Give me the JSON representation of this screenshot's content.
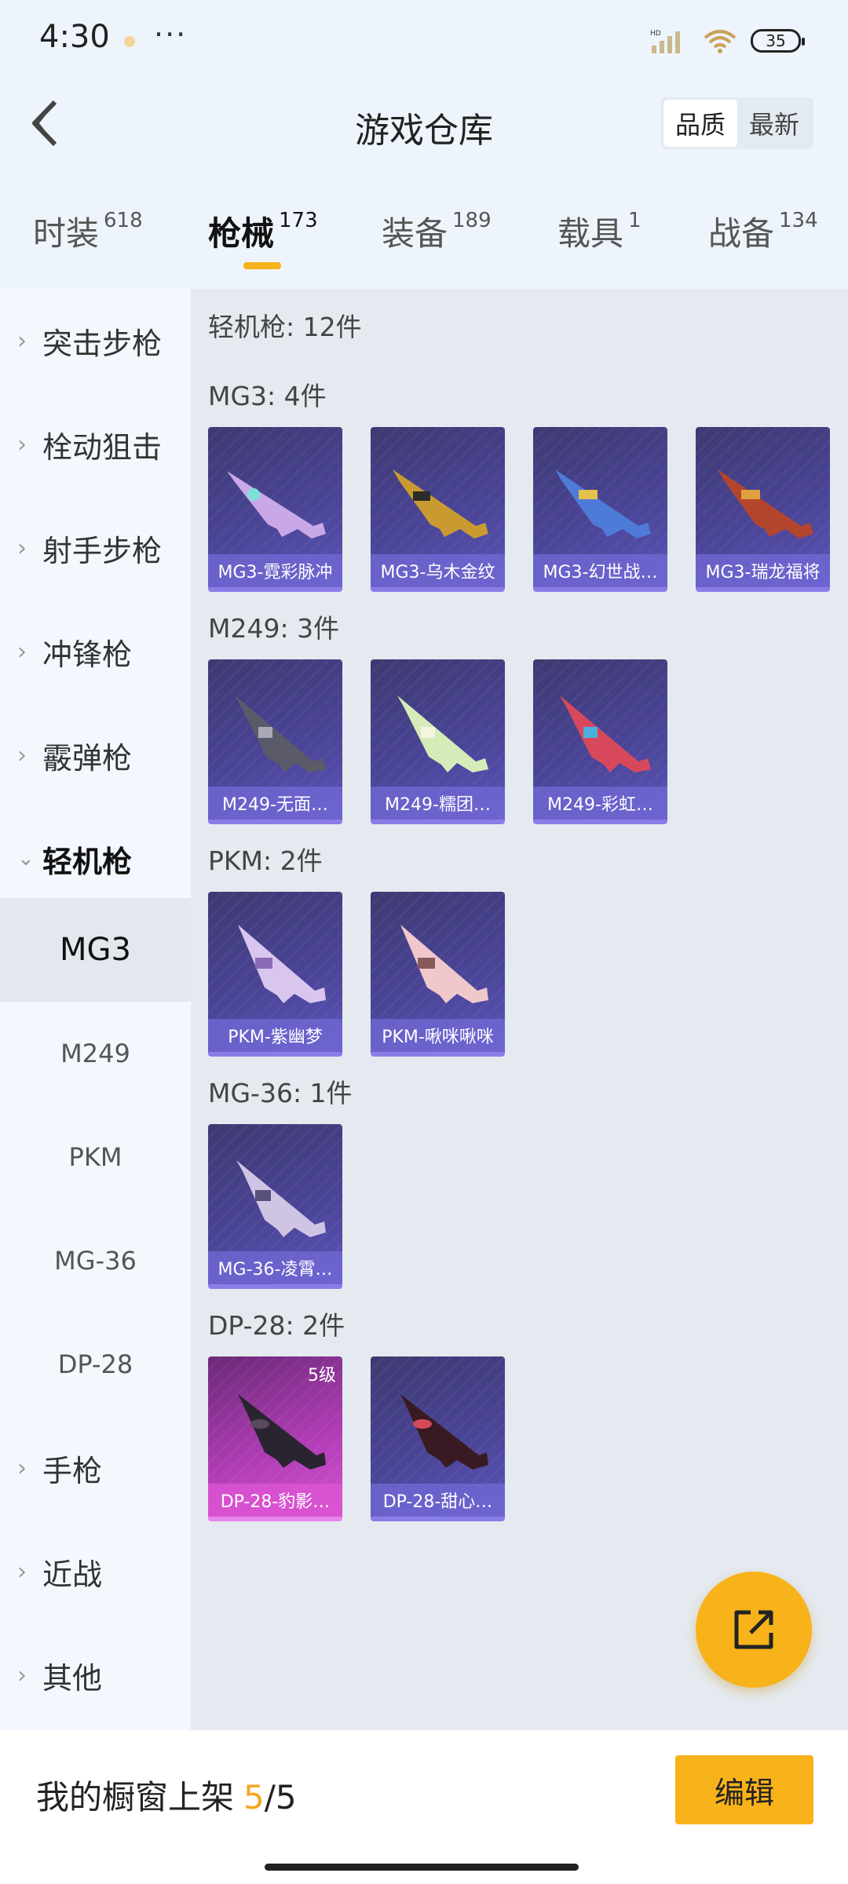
{
  "status": {
    "time": "4:30",
    "more": "···",
    "battery": "35"
  },
  "header": {
    "title": "游戏仓库",
    "sort": [
      "品质",
      "最新"
    ]
  },
  "tabs": [
    {
      "label": "时装",
      "count": "618"
    },
    {
      "label": "枪械",
      "count": "173"
    },
    {
      "label": "装备",
      "count": "189"
    },
    {
      "label": "载具",
      "count": "1"
    },
    {
      "label": "战备",
      "count": "134"
    }
  ],
  "sidebar": {
    "categories": [
      "突击步枪",
      "栓动狙击",
      "射手步枪",
      "冲锋枪",
      "霰弹枪",
      "轻机枪",
      "手枪",
      "近战",
      "其他"
    ],
    "subitems": [
      "MG3",
      "M249",
      "PKM",
      "MG-36",
      "DP-28"
    ]
  },
  "content": {
    "summary": "轻机枪: 12件",
    "groups": [
      {
        "title": "MG3: 4件",
        "items": [
          "MG3-霓彩脉冲",
          "MG3-乌木金纹",
          "MG3-幻世战…",
          "MG3-瑞龙福将"
        ]
      },
      {
        "title": "M249: 3件",
        "items": [
          "M249-无面…",
          "M249-糯团…",
          "M249-彩虹…"
        ]
      },
      {
        "title": "PKM: 2件",
        "items": [
          "PKM-紫幽梦",
          "PKM-啾咪啾咪"
        ]
      },
      {
        "title": "MG-36: 1件",
        "items": [
          "MG-36-凌霄…"
        ]
      },
      {
        "title": "DP-28: 2件",
        "items": [
          "DP-28-豹影…",
          "DP-28-甜心…"
        ],
        "level": "5级"
      }
    ]
  },
  "bottom": {
    "showcase_label": "我的橱窗上架",
    "showcase_current": "5",
    "showcase_sep": "/",
    "showcase_total": "5",
    "edit": "编辑"
  },
  "colors": {
    "accent": "#f8b21a",
    "card_purple": "#4a4496",
    "card_pink": "#b33db8"
  }
}
